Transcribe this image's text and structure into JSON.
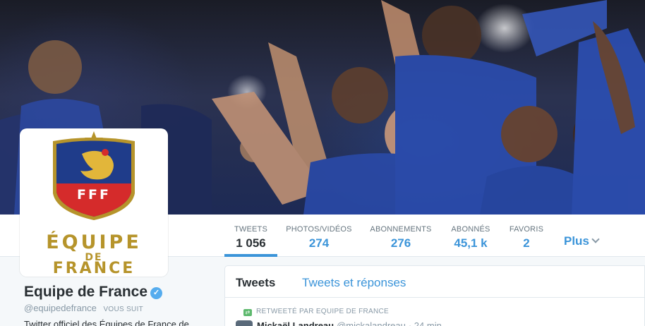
{
  "profile": {
    "name": "Equipe de France",
    "handle": "@equipedefrance",
    "follows_you": "VOUS SUIT",
    "bio": "Twitter officiel des Équipes de France de",
    "verified_icon": "verified-checkmark-icon",
    "logo": {
      "line1": "ÉQUIPE",
      "line2": "DE",
      "line3": "FRANCE",
      "badge_text": "FFF"
    }
  },
  "nav": {
    "tweets": {
      "label": "TWEETS",
      "value": "1 056"
    },
    "photos": {
      "label": "PHOTOS/VIDÉOS",
      "value": "274"
    },
    "following": {
      "label": "ABONNEMENTS",
      "value": "276"
    },
    "followers": {
      "label": "ABONNÉS",
      "value": "45,1 k"
    },
    "favorites": {
      "label": "FAVORIS",
      "value": "2"
    },
    "more": "Plus"
  },
  "timeline": {
    "tabs": [
      "Tweets",
      "Tweets et réponses"
    ],
    "retweet_label": "RETWEETÉ PAR EQUIPE DE FRANCE",
    "tweet": {
      "author": "Mickaël Landreau",
      "handle": "@mickalandreau",
      "time": "· 24 min"
    }
  },
  "colors": {
    "link_blue": "#3b94d9",
    "gold": "#b6942b",
    "navy": "#1f3c8a"
  }
}
